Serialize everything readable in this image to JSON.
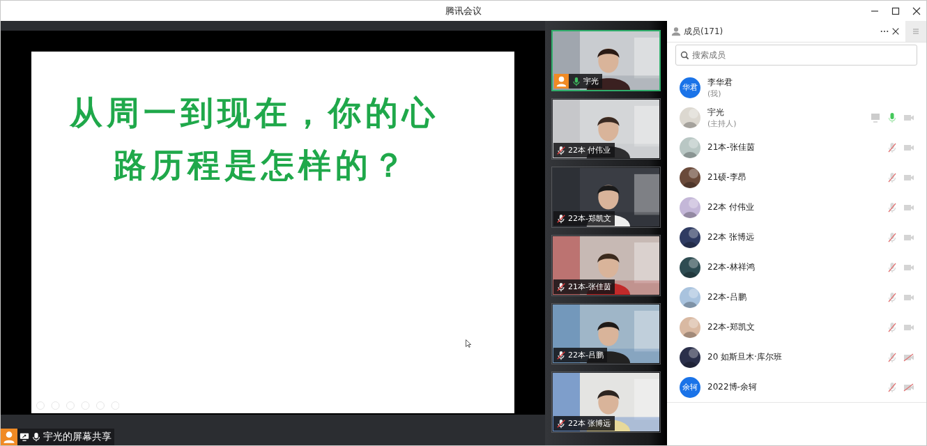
{
  "window": {
    "title": "腾讯会议"
  },
  "share": {
    "slide_lines": [
      "从周一到现在，你的心",
      "路历程是怎样的？"
    ],
    "label": "宇光的屏幕共享",
    "mic_on": true
  },
  "videos": [
    {
      "name": "宇光",
      "mic_on": true,
      "speaking": true,
      "host": true
    },
    {
      "name": "22本 付伟业",
      "mic_on": false,
      "speaking": false,
      "host": false
    },
    {
      "name": "22本-郑凯文",
      "mic_on": false,
      "speaking": false,
      "host": false
    },
    {
      "name": "21本-张佳茵",
      "mic_on": false,
      "speaking": false,
      "host": false
    },
    {
      "name": "22本-吕鹏",
      "mic_on": false,
      "speaking": false,
      "host": false
    },
    {
      "name": "22本 张博远",
      "mic_on": false,
      "speaking": false,
      "host": false
    }
  ],
  "members_panel": {
    "title": "成员(171)",
    "search": {
      "placeholder": "搜索成员"
    },
    "members": [
      {
        "avatar": {
          "kind": "initials",
          "text": "华君"
        },
        "name": "李华君",
        "role": "(我)",
        "kind": "self"
      },
      {
        "name": "宇光",
        "role": "(主持人)",
        "kind": "host",
        "mic_on": true,
        "camera_blocked": false
      },
      {
        "name": "21本-张佳茵",
        "kind": "member",
        "mic_on": false,
        "camera_blocked": false
      },
      {
        "name": "21硕-李昂",
        "kind": "member",
        "mic_on": false,
        "camera_blocked": false
      },
      {
        "name": "22本 付伟业",
        "kind": "member",
        "mic_on": false,
        "camera_blocked": false
      },
      {
        "name": "22本 张博远",
        "kind": "member",
        "mic_on": false,
        "camera_blocked": false
      },
      {
        "name": "22本-林祥鸿",
        "kind": "member",
        "mic_on": false,
        "camera_blocked": false
      },
      {
        "name": "22本-吕鹏",
        "kind": "member",
        "mic_on": false,
        "camera_blocked": false
      },
      {
        "name": "22本-郑凯文",
        "kind": "member",
        "mic_on": false,
        "camera_blocked": false
      },
      {
        "name": "20 如斯旦木·库尔班",
        "kind": "member",
        "mic_on": false,
        "camera_blocked": true
      },
      {
        "avatar": {
          "kind": "initials",
          "text": "余轲"
        },
        "name": "2022博-余轲",
        "kind": "member",
        "mic_on": false,
        "camera_blocked": true
      }
    ]
  }
}
